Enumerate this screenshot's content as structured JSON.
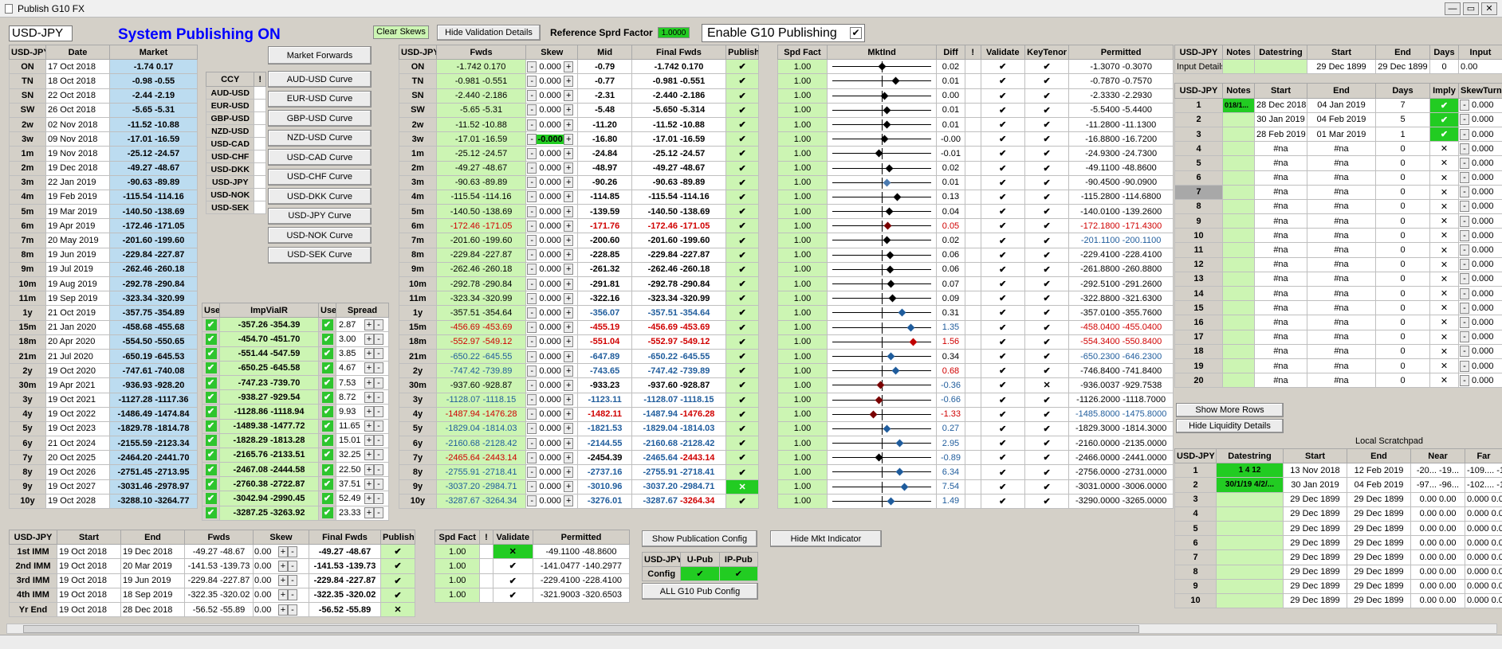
{
  "window": {
    "title": "Publish G10 FX"
  },
  "header": {
    "pair": "USD-JPY",
    "status": "System Publishing ON",
    "clear_skews": "Clear Skews",
    "hide_validation": "Hide Validation Details",
    "ref_label": "Reference Sprd Factor",
    "ref_value": "1.0000",
    "enable_label": "Enable G10 Publishing",
    "enable_check": "✔"
  },
  "colors": {
    "blue": "#bcdcf0",
    "green": "#ccf5b3",
    "bright_green": "#22cc22",
    "status_blue": "#0000ff"
  },
  "market": {
    "headers": [
      "USD-JPY",
      "Date",
      "Market"
    ],
    "rows": [
      [
        "ON",
        "17 Oct 2018",
        "-1.74 0.17"
      ],
      [
        "TN",
        "18 Oct 2018",
        "-0.98 -0.55"
      ],
      [
        "SN",
        "22 Oct 2018",
        "-2.44 -2.19"
      ],
      [
        "SW",
        "26 Oct 2018",
        "-5.65 -5.31"
      ],
      [
        "2w",
        "02 Nov 2018",
        "-11.52 -10.88"
      ],
      [
        "3w",
        "09 Nov 2018",
        "-17.01 -16.59"
      ],
      [
        "1m",
        "19 Nov 2018",
        "-25.12 -24.57"
      ],
      [
        "2m",
        "19 Dec 2018",
        "-49.27 -48.67"
      ],
      [
        "3m",
        "22 Jan 2019",
        "-90.63 -89.89"
      ],
      [
        "4m",
        "19 Feb 2019",
        "-115.54 -114.16"
      ],
      [
        "5m",
        "19 Mar 2019",
        "-140.50 -138.69"
      ],
      [
        "6m",
        "19 Apr 2019",
        "-172.46 -171.05"
      ],
      [
        "7m",
        "20 May 2019",
        "-201.60 -199.60"
      ],
      [
        "8m",
        "19 Jun 2019",
        "-229.84 -227.87"
      ],
      [
        "9m",
        "19 Jul 2019",
        "-262.46 -260.18"
      ],
      [
        "10m",
        "19 Aug 2019",
        "-292.78 -290.84"
      ],
      [
        "11m",
        "19 Sep 2019",
        "-323.34 -320.99"
      ],
      [
        "1y",
        "21 Oct 2019",
        "-357.75 -354.89"
      ],
      [
        "15m",
        "21 Jan 2020",
        "-458.68 -455.68"
      ],
      [
        "18m",
        "20 Apr 2020",
        "-554.50 -550.65"
      ],
      [
        "21m",
        "21 Jul 2020",
        "-650.19 -645.53"
      ],
      [
        "2y",
        "19 Oct 2020",
        "-747.61 -740.08"
      ],
      [
        "30m",
        "19 Apr 2021",
        "-936.93 -928.20"
      ],
      [
        "3y",
        "19 Oct 2021",
        "-1127.28 -1117.36"
      ],
      [
        "4y",
        "19 Oct 2022",
        "-1486.49 -1474.84"
      ],
      [
        "5y",
        "19 Oct 2023",
        "-1829.78 -1814.78"
      ],
      [
        "6y",
        "21 Oct 2024",
        "-2155.59 -2123.34"
      ],
      [
        "7y",
        "20 Oct 2025",
        "-2464.20 -2441.70"
      ],
      [
        "8y",
        "19 Oct 2026",
        "-2751.45 -2713.95"
      ],
      [
        "9y",
        "19 Oct 2027",
        "-3031.46 -2978.97"
      ],
      [
        "10y",
        "19 Oct 2028",
        "-3288.10 -3264.77"
      ]
    ]
  },
  "ccy": {
    "headers": [
      "CCY",
      "!"
    ],
    "rows": [
      "AUD-USD",
      "EUR-USD",
      "GBP-USD",
      "NZD-USD",
      "USD-CAD",
      "USD-CHF",
      "USD-DKK",
      "USD-JPY",
      "USD-NOK",
      "USD-SEK"
    ]
  },
  "curve_buttons": [
    "Market Forwards",
    "AUD-USD Curve",
    "EUR-USD Curve",
    "GBP-USD Curve",
    "NZD-USD Curve",
    "USD-CAD Curve",
    "USD-CHF Curve",
    "USD-DKK Curve",
    "USD-JPY Curve",
    "USD-NOK Curve",
    "USD-SEK Curve"
  ],
  "impvia": {
    "headers": [
      "Use",
      "ImpViaIR",
      "Use",
      "Spread"
    ],
    "rows": [
      [
        "-357.26 -354.39",
        "2.87"
      ],
      [
        "-454.70 -451.70",
        "3.00"
      ],
      [
        "-551.44 -547.59",
        "3.85"
      ],
      [
        "-650.25 -645.58",
        "4.67"
      ],
      [
        "-747.23 -739.70",
        "7.53"
      ],
      [
        "-938.27 -929.54",
        "8.72"
      ],
      [
        "-1128.86 -1118.94",
        "9.93"
      ],
      [
        "-1489.38 -1477.72",
        "11.65"
      ],
      [
        "-1828.29 -1813.28",
        "15.01"
      ],
      [
        "-2165.76 -2133.51",
        "32.25"
      ],
      [
        "-2467.08 -2444.58",
        "22.50"
      ],
      [
        "-2760.38 -2722.87",
        "37.51"
      ],
      [
        "-3042.94 -2990.45",
        "52.49"
      ],
      [
        "-3287.25 -3263.92",
        "23.33"
      ]
    ]
  },
  "fwds": {
    "headers": [
      "USD-JPY",
      "Fwds",
      "Skew",
      "Mid",
      "Final Fwds",
      "Publish"
    ],
    "rows": [
      [
        "ON",
        "-1.742 0.170",
        "0.000",
        "-0.79",
        "-1.742 0.170",
        "✔"
      ],
      [
        "TN",
        "-0.981 -0.551",
        "0.000",
        "-0.77",
        "-0.981 -0.551",
        "✔"
      ],
      [
        "SN",
        "-2.440 -2.186",
        "0.000",
        "-2.31",
        "-2.440 -2.186",
        "✔"
      ],
      [
        "SW",
        "-5.65 -5.31",
        "0.000",
        "-5.48",
        "-5.650 -5.314",
        "✔"
      ],
      [
        "2w",
        "-11.52 -10.88",
        "0.000",
        "-11.20",
        "-11.52 -10.88",
        "✔"
      ],
      [
        "3w",
        "-17.01 -16.59",
        "-0.000",
        "-16.80",
        "-17.01 -16.59",
        "✔"
      ],
      [
        "1m",
        "-25.12 -24.57",
        "0.000",
        "-24.84",
        "-25.12 -24.57",
        "✔"
      ],
      [
        "2m",
        "-49.27 -48.67",
        "0.000",
        "-48.97",
        "-49.27 -48.67",
        "✔"
      ],
      [
        "3m",
        "-90.63 -89.89",
        "0.000",
        "-90.26",
        "-90.63 -89.89",
        "✔"
      ],
      [
        "4m",
        "-115.54 -114.16",
        "0.000",
        "-114.85",
        "-115.54 -114.16",
        "✔"
      ],
      [
        "5m",
        "-140.50 -138.69",
        "0.000",
        "-139.59",
        "-140.50 -138.69",
        "✔"
      ],
      [
        "6m",
        "-172.46 -171.05",
        "0.000",
        "-171.76",
        "-172.46 -171.05",
        "✔"
      ],
      [
        "7m",
        "-201.60 -199.60",
        "0.000",
        "-200.60",
        "-201.60 -199.60",
        "✔"
      ],
      [
        "8m",
        "-229.84 -227.87",
        "0.000",
        "-228.85",
        "-229.84 -227.87",
        "✔"
      ],
      [
        "9m",
        "-262.46 -260.18",
        "0.000",
        "-261.32",
        "-262.46 -260.18",
        "✔"
      ],
      [
        "10m",
        "-292.78 -290.84",
        "0.000",
        "-291.81",
        "-292.78 -290.84",
        "✔"
      ],
      [
        "11m",
        "-323.34 -320.99",
        "0.000",
        "-322.16",
        "-323.34 -320.99",
        "✔"
      ],
      [
        "1y",
        "-357.51 -354.64",
        "0.000",
        "-356.07",
        "-357.51 -354.64",
        "✔"
      ],
      [
        "15m",
        "-456.69 -453.69",
        "0.000",
        "-455.19",
        "-456.69 -453.69",
        "✔"
      ],
      [
        "18m",
        "-552.97 -549.12",
        "0.000",
        "-551.04",
        "-552.97 -549.12",
        "✔"
      ],
      [
        "21m",
        "-650.22 -645.55",
        "0.000",
        "-647.89",
        "-650.22 -645.55",
        "✔"
      ],
      [
        "2y",
        "-747.42 -739.89",
        "0.000",
        "-743.65",
        "-747.42 -739.89",
        "✔"
      ],
      [
        "30m",
        "-937.60 -928.87",
        "0.000",
        "-933.23",
        "-937.60 -928.87",
        "✔"
      ],
      [
        "3y",
        "-1128.07 -1118.15",
        "0.000",
        "-1123.11",
        "-1128.07 -1118.15",
        "✔"
      ],
      [
        "4y",
        "-1487.94 -1476.28",
        "0.000",
        "-1482.11",
        "-1487.94 -1476.28",
        "✔"
      ],
      [
        "5y",
        "-1829.04 -1814.03",
        "0.000",
        "-1821.53",
        "-1829.04 -1814.03",
        "✔"
      ],
      [
        "6y",
        "-2160.68 -2128.42",
        "0.000",
        "-2144.55",
        "-2160.68 -2128.42",
        "✔"
      ],
      [
        "7y",
        "-2465.64 -2443.14",
        "0.000",
        "-2454.39",
        "-2465.64 -2443.14",
        "✔"
      ],
      [
        "8y",
        "-2755.91 -2718.41",
        "0.000",
        "-2737.16",
        "-2755.91 -2718.41",
        "✔"
      ],
      [
        "9y",
        "-3037.20 -2984.71",
        "0.000",
        "-3010.96",
        "-3037.20 -2984.71",
        "✕"
      ],
      [
        "10y",
        "-3287.67 -3264.34",
        "0.000",
        "-3276.01",
        "-3287.67 -3264.34",
        "✔"
      ]
    ]
  },
  "validation": {
    "headers": [
      "Spd Fact",
      "MktInd",
      "Diff",
      "!",
      "Validate",
      "KeyTenor",
      "Permitted"
    ],
    "rows": [
      [
        "1.00",
        "0.02",
        "✔",
        "✔",
        "-1.3070 -0.3070"
      ],
      [
        "1.00",
        "0.01",
        "✔",
        "✔",
        "-0.7870 -0.7570"
      ],
      [
        "1.00",
        "0.00",
        "✔",
        "✔",
        "-2.3330 -2.2930"
      ],
      [
        "1.00",
        "0.01",
        "✔",
        "✔",
        "-5.5400 -5.4400"
      ],
      [
        "1.00",
        "0.01",
        "✔",
        "✔",
        "-11.2800 -11.1300"
      ],
      [
        "1.00",
        "-0.00",
        "✔",
        "✔",
        "-16.8800 -16.7200"
      ],
      [
        "1.00",
        "-0.01",
        "✔",
        "✔",
        "-24.9300 -24.7300"
      ],
      [
        "1.00",
        "0.02",
        "✔",
        "✔",
        "-49.1100 -48.8600"
      ],
      [
        "1.00",
        "0.01",
        "✔",
        "✔",
        "-90.4500 -90.0900"
      ],
      [
        "1.00",
        "0.13",
        "✔",
        "✔",
        "-115.2800 -114.6800"
      ],
      [
        "1.00",
        "0.04",
        "✔",
        "✔",
        "-140.0100 -139.2600"
      ],
      [
        "1.00",
        "0.05",
        "✔",
        "✔",
        "-172.1800 -171.4300"
      ],
      [
        "1.00",
        "0.02",
        "✔",
        "✔",
        "-201.1100 -200.1100"
      ],
      [
        "1.00",
        "0.06",
        "✔",
        "✔",
        "-229.4100 -228.4100"
      ],
      [
        "1.00",
        "0.06",
        "✔",
        "✔",
        "-261.8800 -260.8800"
      ],
      [
        "1.00",
        "0.07",
        "✔",
        "✔",
        "-292.5100 -291.2600"
      ],
      [
        "1.00",
        "0.09",
        "✔",
        "✔",
        "-322.8800 -321.6300"
      ],
      [
        "1.00",
        "0.31",
        "✔",
        "✔",
        "-357.0100 -355.7600"
      ],
      [
        "1.00",
        "1.35",
        "✔",
        "✔",
        "-458.0400 -455.0400"
      ],
      [
        "1.00",
        "1.56",
        "✔",
        "✔",
        "-554.3400 -550.8400"
      ],
      [
        "1.00",
        "0.34",
        "✔",
        "✔",
        "-650.2300 -646.2300"
      ],
      [
        "1.00",
        "0.68",
        "✔",
        "✔",
        "-746.8400 -741.8400"
      ],
      [
        "1.00",
        "-0.36",
        "✔",
        "✕",
        "-936.0037 -929.7538"
      ],
      [
        "1.00",
        "-0.66",
        "✔",
        "✔",
        "-1126.2000 -1118.7000"
      ],
      [
        "1.00",
        "-1.33",
        "✔",
        "✔",
        "-1485.8000 -1475.8000"
      ],
      [
        "1.00",
        "0.27",
        "✔",
        "✔",
        "-1829.3000 -1814.3000"
      ],
      [
        "1.00",
        "2.95",
        "✔",
        "✔",
        "-2160.0000 -2135.0000"
      ],
      [
        "1.00",
        "-0.89",
        "✔",
        "✔",
        "-2466.0000 -2441.0000"
      ],
      [
        "1.00",
        "6.34",
        "✔",
        "✔",
        "-2756.0000 -2731.0000"
      ],
      [
        "1.00",
        "7.54",
        "✔",
        "✔",
        "-3031.0000 -3006.0000"
      ],
      [
        "1.00",
        "1.49",
        "✔",
        "✔",
        "-3290.0000 -3265.0000"
      ]
    ]
  },
  "imm": {
    "headers": [
      "USD-JPY",
      "Start",
      "End",
      "Fwds",
      "Skew",
      "Final Fwds",
      "Publish"
    ],
    "rows": [
      [
        "1st IMM",
        "19 Oct 2018",
        "19 Dec 2018",
        "-49.27 -48.67",
        "0.00",
        "-49.27 -48.67",
        "✔"
      ],
      [
        "2nd IMM",
        "19 Oct 2018",
        "20 Mar 2019",
        "-141.53 -139.73",
        "0.00",
        "-141.53 -139.73",
        "✔"
      ],
      [
        "3rd IMM",
        "19 Oct 2018",
        "19 Jun 2019",
        "-229.84 -227.87",
        "0.00",
        "-229.84 -227.87",
        "✔"
      ],
      [
        "4th IMM",
        "19 Oct 2018",
        "18 Sep 2019",
        "-322.35 -320.02",
        "0.00",
        "-322.35 -320.02",
        "✔"
      ],
      [
        "Yr End",
        "19 Oct 2018",
        "28 Dec 2018",
        "-56.52 -55.89",
        "0.00",
        "-56.52 -55.89",
        "✕"
      ]
    ]
  },
  "imm_valid": {
    "headers": [
      "Spd Fact",
      "!",
      "Validate",
      "Permitted"
    ],
    "rows": [
      [
        "1.00",
        "✕",
        "-49.1100 -48.8600"
      ],
      [
        "1.00",
        "✔",
        "-141.0477 -140.2977"
      ],
      [
        "1.00",
        "✔",
        "-229.4100 -228.4100"
      ],
      [
        "1.00",
        "✔",
        "-321.9003 -320.6503"
      ]
    ]
  },
  "pubconfig": {
    "show": "Show Publication Config",
    "hide_mkt": "Hide Mkt Indicator",
    "pair": "USD-JPY",
    "config": "Config",
    "upub": "U-Pub",
    "ippub": "IP-Pub",
    "all": "ALL G10 Pub Config"
  },
  "input": {
    "headers": [
      "USD-JPY",
      "Notes",
      "Datestring",
      "Start",
      "End",
      "Days",
      "Input"
    ],
    "label": "Input Details",
    "start": "29 Dec 1899",
    "end": "29 Dec 1899",
    "days": "0",
    "input": "0.00",
    "sub_headers": [
      "USD-JPY",
      "Notes",
      "Start",
      "End",
      "Days",
      "Imply",
      "SkewTurn"
    ],
    "rows": [
      [
        "1",
        "018/1...",
        "28 Dec 2018",
        "04 Jan 2019",
        "7",
        "0.000"
      ],
      [
        "2",
        "",
        "30 Jan 2019",
        "04 Feb 2019",
        "5",
        "0.000"
      ],
      [
        "3",
        "",
        "28 Feb 2019",
        "01 Mar 2019",
        "1",
        "0.000"
      ],
      [
        "4",
        "",
        "#na",
        "#na",
        "0",
        "0.000"
      ],
      [
        "5",
        "",
        "#na",
        "#na",
        "0",
        "0.000"
      ],
      [
        "6",
        "",
        "#na",
        "#na",
        "0",
        "0.000"
      ],
      [
        "7",
        "",
        "#na",
        "#na",
        "0",
        "0.000"
      ],
      [
        "8",
        "",
        "#na",
        "#na",
        "0",
        "0.000"
      ],
      [
        "9",
        "",
        "#na",
        "#na",
        "0",
        "0.000"
      ],
      [
        "10",
        "",
        "#na",
        "#na",
        "0",
        "0.000"
      ],
      [
        "11",
        "",
        "#na",
        "#na",
        "0",
        "0.000"
      ],
      [
        "12",
        "",
        "#na",
        "#na",
        "0",
        "0.000"
      ],
      [
        "13",
        "",
        "#na",
        "#na",
        "0",
        "0.000"
      ],
      [
        "14",
        "",
        "#na",
        "#na",
        "0",
        "0.000"
      ],
      [
        "15",
        "",
        "#na",
        "#na",
        "0",
        "0.000"
      ],
      [
        "16",
        "",
        "#na",
        "#na",
        "0",
        "0.000"
      ],
      [
        "17",
        "",
        "#na",
        "#na",
        "0",
        "0.000"
      ],
      [
        "18",
        "",
        "#na",
        "#na",
        "0",
        "0.000"
      ],
      [
        "19",
        "",
        "#na",
        "#na",
        "0",
        "0.000"
      ],
      [
        "20",
        "",
        "#na",
        "#na",
        "0",
        "0.000"
      ]
    ],
    "show_more": "Show More Rows",
    "hide_liq": "Hide Liquidity Details"
  },
  "scratch": {
    "title": "Local Scratchpad",
    "headers": [
      "USD-JPY",
      "Datestring",
      "Start",
      "End",
      "Near",
      "Far"
    ],
    "rows": [
      [
        "1",
        "1 4 12",
        "13 Nov 2018",
        "12 Feb 2019",
        "-20... -19...",
        "-109.... -108"
      ],
      [
        "2",
        "30/1/19 4/2/...",
        "30 Jan 2019",
        "04 Feb 2019",
        "-97... -96...",
        "-102.... -101"
      ],
      [
        "3",
        "",
        "29 Dec 1899",
        "29 Dec 1899",
        "0.00 0.00",
        "0.000 0.00"
      ],
      [
        "4",
        "",
        "29 Dec 1899",
        "29 Dec 1899",
        "0.00 0.00",
        "0.000 0.00"
      ],
      [
        "5",
        "",
        "29 Dec 1899",
        "29 Dec 1899",
        "0.00 0.00",
        "0.000 0.00"
      ],
      [
        "6",
        "",
        "29 Dec 1899",
        "29 Dec 1899",
        "0.00 0.00",
        "0.000 0.00"
      ],
      [
        "7",
        "",
        "29 Dec 1899",
        "29 Dec 1899",
        "0.00 0.00",
        "0.000 0.00"
      ],
      [
        "8",
        "",
        "29 Dec 1899",
        "29 Dec 1899",
        "0.00 0.00",
        "0.000 0.00"
      ],
      [
        "9",
        "",
        "29 Dec 1899",
        "29 Dec 1899",
        "0.00 0.00",
        "0.000 0.00"
      ],
      [
        "10",
        "",
        "29 Dec 1899",
        "29 Dec 1899",
        "0.00 0.00",
        "0.000 0.00"
      ]
    ]
  },
  "mktind": [
    0.48,
    0.6,
    0.5,
    0.52,
    0.52,
    0.5,
    0.45,
    0.54,
    0.52,
    0.62,
    0.54,
    0.53,
    0.52,
    0.55,
    0.55,
    0.56,
    0.57,
    0.66,
    0.74,
    0.76,
    0.56,
    0.6,
    0.46,
    0.45,
    0.4,
    0.52,
    0.64,
    0.45,
    0.64,
    0.68,
    0.56
  ],
  "mktind_colors": [
    "#000",
    "#000",
    "#000",
    "#000",
    "#000",
    "#000",
    "#000",
    "#000",
    "#4a7ab0",
    "#000",
    "#000",
    "#7a0000",
    "#000",
    "#000",
    "#000",
    "#000",
    "#000",
    "#1f5c9c",
    "#1f5c9c",
    "#c00000",
    "#1f5c9c",
    "#1f5c9c",
    "#7a0000",
    "#7a0000",
    "#7a0000",
    "#1f5c9c",
    "#1f5c9c",
    "#000",
    "#1f5c9c",
    "#1f5c9c",
    "#1f5c9c"
  ]
}
